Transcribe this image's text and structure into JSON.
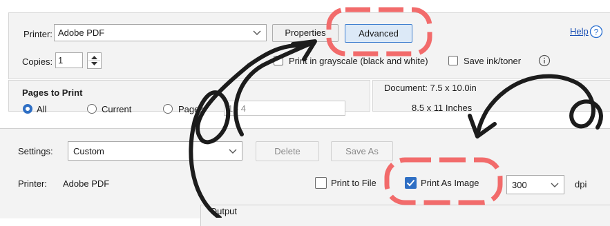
{
  "top_dialog": {
    "printer_label": "Printer:",
    "printer_value": "Adobe PDF",
    "properties_button": "Properties",
    "advanced_button": "Advanced",
    "help_link": "Help",
    "copies_label": "Copies:",
    "copies_value": "1",
    "grayscale_label": "Print in grayscale (black and white)",
    "save_ink_label": "Save ink/toner",
    "pages_to_print_heading": "Pages to Print",
    "radio_all": "All",
    "radio_current": "Current",
    "radio_pages": "Pages",
    "pages_range_value": "1 - 4",
    "document_size": "Document: 7.5 x 10.0in",
    "paper_size": "8.5 x 11 Inches"
  },
  "bottom_dialog": {
    "settings_label": "Settings:",
    "settings_value": "Custom",
    "delete_button": "Delete",
    "save_as_button": "Save As",
    "printer_label": "Printer:",
    "printer_value": "Adobe PDF",
    "print_to_file_label": "Print to File",
    "print_as_image_label": "Print As Image",
    "print_as_image_checked": true,
    "dpi_value": "300",
    "dpi_unit": "dpi",
    "output_label": "Output"
  },
  "annotation_colors": {
    "highlight": "#f26b6b",
    "arrow": "#1c1c1c"
  }
}
